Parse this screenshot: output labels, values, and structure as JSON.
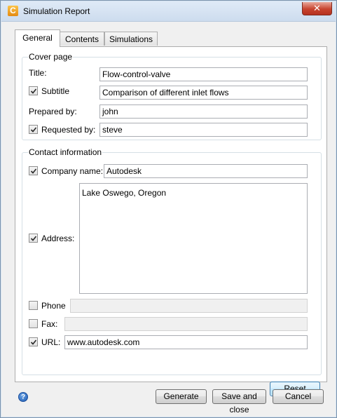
{
  "window": {
    "title": "Simulation Report",
    "app_icon_glyph": "C",
    "close_glyph": "✕"
  },
  "tabs": [
    {
      "label": "General",
      "active": true
    },
    {
      "label": "Contents",
      "active": false
    },
    {
      "label": "Simulations",
      "active": false
    }
  ],
  "cover_page": {
    "legend": "Cover page",
    "title": {
      "label": "Title:",
      "value": "Flow-control-valve"
    },
    "subtitle": {
      "label": "Subtitle",
      "checked": true,
      "value": "Comparison of different inlet flows"
    },
    "prepared_by": {
      "label": "Prepared by:",
      "value": "john"
    },
    "requested_by": {
      "label": "Requested by:",
      "checked": true,
      "value": "steve"
    }
  },
  "contact": {
    "legend": "Contact information",
    "company": {
      "label": "Company name:",
      "checked": true,
      "value": "Autodesk"
    },
    "address": {
      "label": "Address:",
      "checked": true,
      "value": "Lake Oswego, Oregon"
    },
    "phone": {
      "label": "Phone",
      "checked": false,
      "value": ""
    },
    "fax": {
      "label": "Fax:",
      "checked": false,
      "value": ""
    },
    "url": {
      "label": "URL:",
      "checked": true,
      "value": "www.autodesk.com"
    }
  },
  "buttons": {
    "reset": "Reset",
    "generate": "Generate",
    "save_close": "Save and close",
    "cancel": "Cancel"
  },
  "icons": {
    "help": "?",
    "check": "checkmark-icon"
  }
}
